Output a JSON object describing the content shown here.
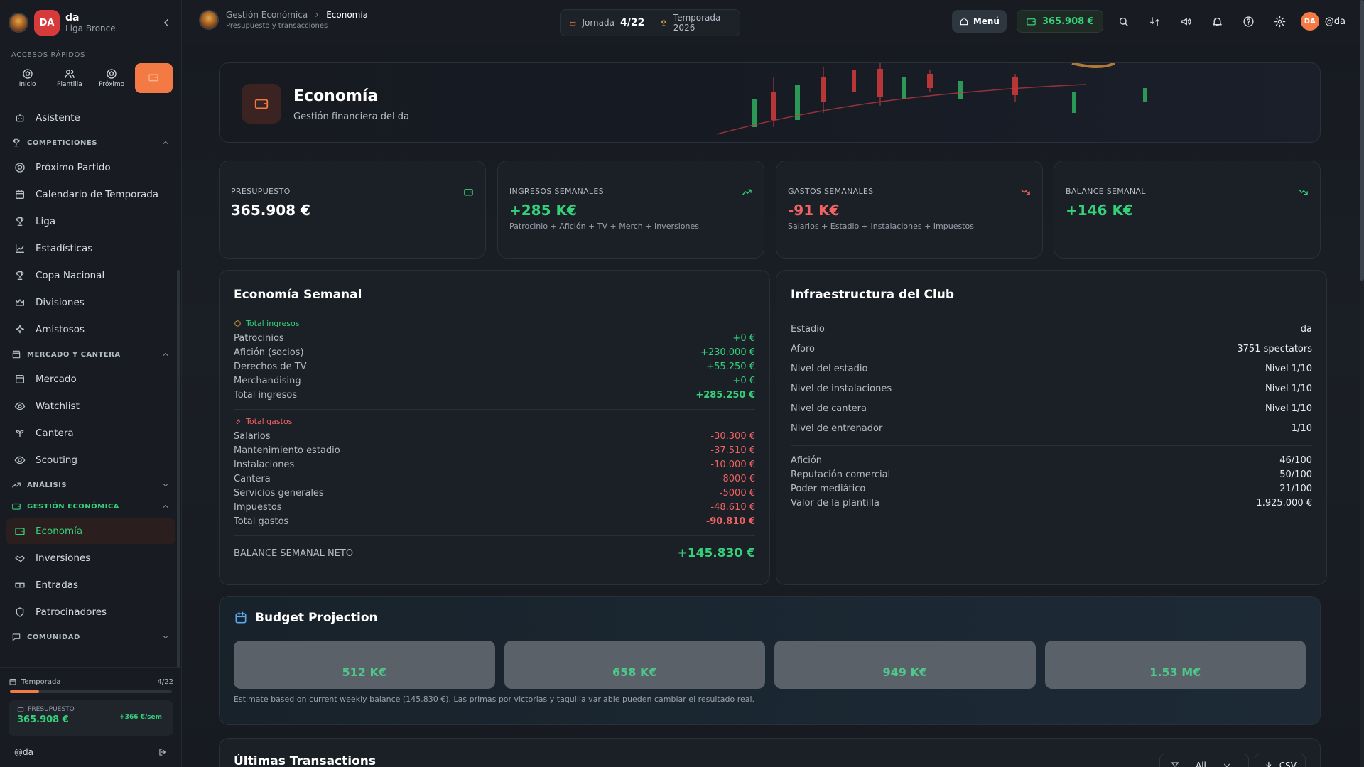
{
  "club": {
    "name": "da",
    "league": "Liga Bronce",
    "initials": "DA"
  },
  "sidebar": {
    "quick_access_label": "Accesos rápidos",
    "quick": [
      {
        "label": "Inicio",
        "icon": "ball-icon"
      },
      {
        "label": "Plantilla",
        "icon": "users-icon"
      },
      {
        "label": "Próximo",
        "icon": "ball-icon"
      },
      {
        "label": "",
        "icon": "wallet-icon"
      }
    ],
    "assistant": "Asistente",
    "groups": {
      "competiciones": "Competiciones",
      "mercado": "Mercado y cantera",
      "analisis": "Análisis",
      "gestion": "Gestión económica",
      "comunidad": "Comunidad"
    },
    "items": {
      "proximo": "Próximo Partido",
      "calendario": "Calendario de Temporada",
      "liga": "Liga",
      "estadisticas": "Estadísticas",
      "copa": "Copa Nacional",
      "divisiones": "Divisiones",
      "amistosos": "Amistosos",
      "mercado": "Mercado",
      "watchlist": "Watchlist",
      "cantera": "Cantera",
      "scouting": "Scouting",
      "economia": "Economía",
      "inversiones": "Inversiones",
      "entradas": "Entradas",
      "patrocinadores": "Patrocinadores"
    },
    "footer": {
      "season_label": "Temporada",
      "season_value": "4/22",
      "season_progress": 0.18,
      "budget_label": "Presupuesto",
      "budget_amount": "365.908 €",
      "budget_rate": "+366 €/sem",
      "user": "@da"
    }
  },
  "topbar": {
    "crumb_parent": "Gestión Económica",
    "crumb_current": "Economía",
    "crumb_sub": "Presupuesto y transacciones",
    "jornada_label": "Jornada",
    "jornada_value": "4/22",
    "season": "Temporada 2026",
    "menu_label": "Menú",
    "balance": "365.908 €",
    "user": "@da",
    "user_initials": "DA"
  },
  "hero": {
    "title": "Economía",
    "subtitle": "Gestión financiera del da"
  },
  "stats": [
    {
      "label": "Presupuesto",
      "value": "365.908 €",
      "hint": ""
    },
    {
      "label": "Ingresos semanales",
      "value": "+285 K€",
      "hint": "Patrocinio + Afición + TV + Merch + Inversiones"
    },
    {
      "label": "Gastos semanales",
      "value": "-91 K€",
      "hint": "Salarios + Estadio + Instalaciones + Impuestos"
    },
    {
      "label": "Balance semanal",
      "value": "+146 K€",
      "hint": ""
    }
  ],
  "weekly": {
    "title": "Economía Semanal",
    "income_head": "Total ingresos",
    "income": [
      {
        "label": "Patrocinios",
        "value": "+0 €"
      },
      {
        "label": "Afición (socios)",
        "value": "+230.000 €"
      },
      {
        "label": "Derechos de TV",
        "value": "+55.250 €"
      },
      {
        "label": "Merchandising",
        "value": "+0 €"
      }
    ],
    "income_total_label": "Total ingresos",
    "income_total": "+285.250 €",
    "expense_head": "Total gastos",
    "expenses": [
      {
        "label": "Salarios",
        "value": "-30.300 €"
      },
      {
        "label": "Mantenimiento estadio",
        "value": "-37.510 €"
      },
      {
        "label": "Instalaciones",
        "value": "-10.000 €"
      },
      {
        "label": "Cantera",
        "value": "-8000 €"
      },
      {
        "label": "Servicios generales",
        "value": "-5000 €"
      },
      {
        "label": "Impuestos",
        "value": "-48.610 €"
      }
    ],
    "expense_total_label": "Total gastos",
    "expense_total": "-90.810 €",
    "net_label": "Balance semanal neto",
    "net_value": "+145.830 €"
  },
  "infra": {
    "title": "Infraestructura del Club",
    "rows": [
      {
        "label": "Estadio",
        "value": "da"
      },
      {
        "label": "Aforo",
        "value": "3751 spectators"
      },
      {
        "label": "Nivel del estadio",
        "value": "Nivel 1/10"
      },
      {
        "label": "Nivel de instalaciones",
        "value": "Nivel 1/10"
      },
      {
        "label": "Nivel de cantera",
        "value": "Nivel 1/10"
      },
      {
        "label": "Nivel de entrenador",
        "value": "1/10"
      }
    ],
    "rows2": [
      {
        "label": "Afición",
        "value": "46/100"
      },
      {
        "label": "Reputación comercial",
        "value": "50/100"
      },
      {
        "label": "Poder mediático",
        "value": "21/100"
      },
      {
        "label": "Valor de la plantilla",
        "value": "1.925.000 €"
      }
    ]
  },
  "projection": {
    "title": "Budget Projection",
    "values": [
      "512 K€",
      "658 K€",
      "949 K€",
      "1.53 M€"
    ],
    "note": "Estimate based on current weekly balance (145.830 €). Las primas por victorias y taquilla variable pueden cambiar el resultado real."
  },
  "transactions": {
    "title": "Últimas Transactions",
    "filter": "All",
    "csv": "CSV"
  },
  "colors": {
    "accent": "#f47a45",
    "green": "#34d07a",
    "red": "#f06363"
  }
}
